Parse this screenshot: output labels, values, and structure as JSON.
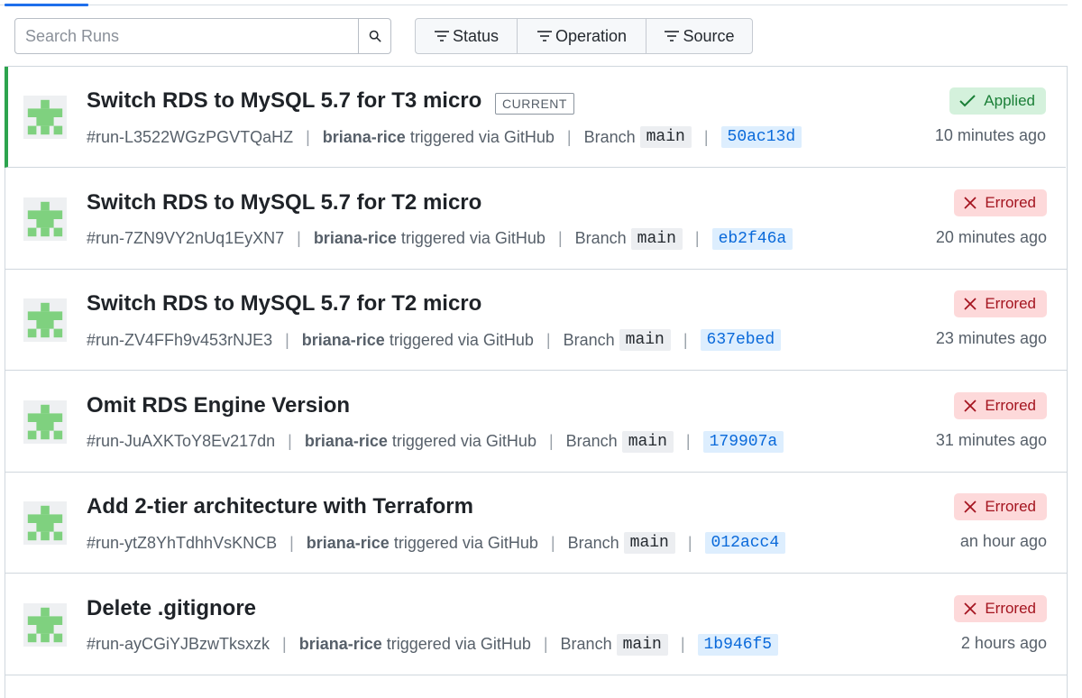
{
  "search": {
    "placeholder": "Search Runs"
  },
  "filters": [
    {
      "label": "Status"
    },
    {
      "label": "Operation"
    },
    {
      "label": "Source"
    }
  ],
  "runs": [
    {
      "title": "Switch RDS to MySQL 5.7 for T3 micro",
      "badge": "CURRENT",
      "id": "#run-L3522WGzPGVTQaHZ",
      "user": "briana-rice",
      "trigger": "triggered via GitHub",
      "branch_label": "Branch",
      "branch": "main",
      "commit": "50ac13d",
      "status": "Applied",
      "time": "10 minutes ago"
    },
    {
      "title": "Switch RDS to MySQL 5.7 for T2 micro",
      "id": "#run-7ZN9VY2nUq1EyXN7",
      "user": "briana-rice",
      "trigger": "triggered via GitHub",
      "branch_label": "Branch",
      "branch": "main",
      "commit": "eb2f46a",
      "status": "Errored",
      "time": "20 minutes ago"
    },
    {
      "title": "Switch RDS to MySQL 5.7 for T2 micro",
      "id": "#run-ZV4FFh9v453rNJE3",
      "user": "briana-rice",
      "trigger": "triggered via GitHub",
      "branch_label": "Branch",
      "branch": "main",
      "commit": "637ebed",
      "status": "Errored",
      "time": "23 minutes ago"
    },
    {
      "title": "Omit RDS Engine Version",
      "id": "#run-JuAXKToY8Ev217dn",
      "user": "briana-rice",
      "trigger": "triggered via GitHub",
      "branch_label": "Branch",
      "branch": "main",
      "commit": "179907a",
      "status": "Errored",
      "time": "31 minutes ago"
    },
    {
      "title": "Add 2-tier architecture with Terraform",
      "id": "#run-ytZ8YhTdhhVsKNCB",
      "user": "briana-rice",
      "trigger": "triggered via GitHub",
      "branch_label": "Branch",
      "branch": "main",
      "commit": "012acc4",
      "status": "Errored",
      "time": "an hour ago"
    },
    {
      "title": "Delete .gitignore",
      "id": "#run-ayCGiYJBzwTksxzk",
      "user": "briana-rice",
      "trigger": "triggered via GitHub",
      "branch_label": "Branch",
      "branch": "main",
      "commit": "1b946f5",
      "status": "Errored",
      "time": "2 hours ago"
    }
  ],
  "colors": {
    "applied_bg": "#d4f1dc",
    "applied_fg": "#1a7f37",
    "errored_bg": "#fdd9da",
    "errored_fg": "#a4141f",
    "avatar_green": "#7fd17f",
    "current_bar": "#2da44e"
  },
  "icons": {
    "search": "search-icon",
    "filter": "filter-icon",
    "check": "check-icon",
    "error": "x-icon",
    "avatar": "identicon-avatar"
  }
}
